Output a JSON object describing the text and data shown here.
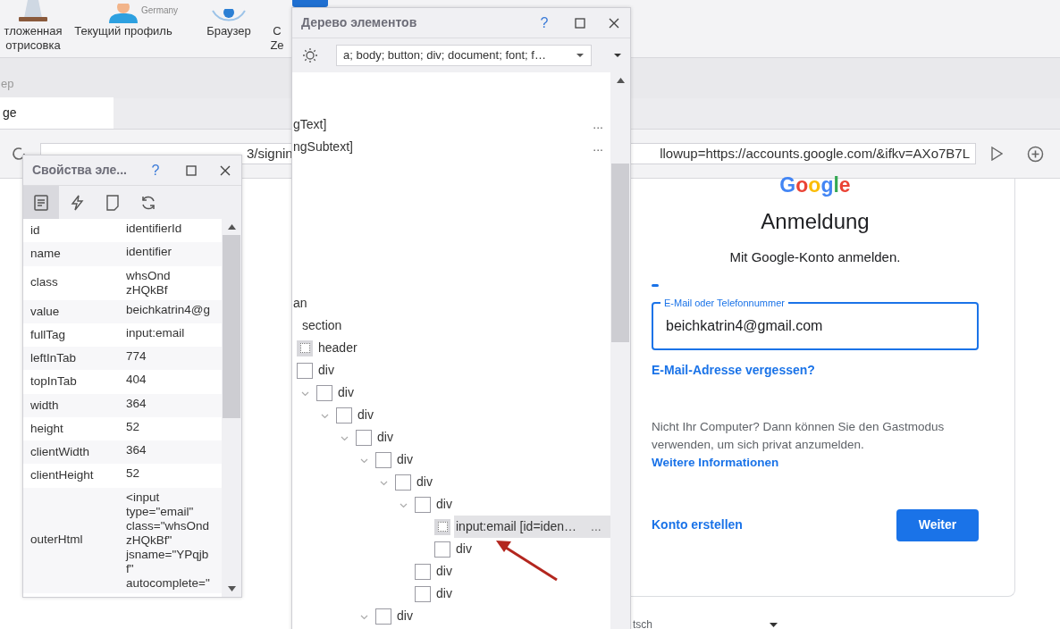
{
  "toolbar": {
    "items": [
      {
        "label": "тложенная\nотрисовка",
        "kind": "lamp"
      },
      {
        "label": "Текущий профиль",
        "kind": "person",
        "info": [
          "Germany"
        ]
      },
      {
        "label": "Браузер",
        "kind": "eye"
      },
      {
        "label": "С\nZe",
        "kind": "plain"
      }
    ]
  },
  "browser": {
    "caption": "ep",
    "tabs": [
      {
        "label": "ge",
        "selected": true
      }
    ],
    "address": {
      "start": "3/signin",
      "end": "llowup=https://accounts.google.com/&ifkv=AXo7B7L"
    },
    "page": {
      "logo": "Google",
      "title": "Anmeldung",
      "subtitle": "Mit Google-Konto anmelden.",
      "email_field": {
        "label": "E-Mail oder Telefonnummer",
        "value": "beichkatrin4@gmail.com",
        "focused": true
      },
      "forgot_link": "E-Mail-Adresse vergessen?",
      "guest_text": "Nicht Ihr Computer? Dann können Sie den Gastmodus verwenden, um sich privat anzumelden.",
      "more_link": "Weitere Informationen",
      "create_link": "Konto erstellen",
      "next_button": "Weiter",
      "language": "tsch"
    }
  },
  "properties_panel": {
    "title": "Свойства эле...",
    "help": "?",
    "tabs": [
      {
        "kind": "document",
        "selected": true
      },
      {
        "kind": "bolt",
        "selected": false
      },
      {
        "kind": "page",
        "selected": false
      },
      {
        "kind": "refresh",
        "selected": false
      }
    ],
    "rows": [
      {
        "name": "id",
        "value": "identifierId"
      },
      {
        "name": "name",
        "value": "identifier"
      },
      {
        "name": "class",
        "value": "whsOnd\nzHQkBf"
      },
      {
        "name": "value",
        "value": "beichkatrin4@g"
      },
      {
        "name": "fullTag",
        "value": "input:email"
      },
      {
        "name": "leftInTab",
        "value": "774"
      },
      {
        "name": "topInTab",
        "value": "404"
      },
      {
        "name": "width",
        "value": "364"
      },
      {
        "name": "height",
        "value": "52"
      },
      {
        "name": "clientWidth",
        "value": "364"
      },
      {
        "name": "clientHeight",
        "value": "52"
      },
      {
        "name": "outerHtml",
        "value": "<input\ntype=\"email\"\nclass=\"whsOnd\nzHQkBf\"\njsname=\"YPqjb\nf\"\nautocomplete=\""
      }
    ]
  },
  "tree_panel": {
    "title": "Дерево элементов",
    "help": "?",
    "filter": "a; body; button; div; document; font; f…",
    "partial_rows": [
      {
        "label": "gText]",
        "more": "..."
      },
      {
        "label": "ngSubtext]",
        "more": "..."
      },
      {
        "label": "an"
      }
    ],
    "items": [
      {
        "label": "section",
        "kind": "plain",
        "selected": false
      },
      {
        "label": "header",
        "kind": "dotted",
        "selected": false
      },
      {
        "label": "div",
        "kind": "box",
        "selected": false,
        "children": [
          {
            "label": "div",
            "kind": "box",
            "selected": false,
            "expanded": true,
            "children": [
              {
                "label": "div",
                "kind": "box",
                "selected": false,
                "expanded": true,
                "children": [
                  {
                    "label": "div",
                    "kind": "box",
                    "selected": false,
                    "expanded": true,
                    "children": [
                      {
                        "label": "div",
                        "kind": "box",
                        "selected": false,
                        "expanded": true,
                        "children": [
                          {
                            "label": "div",
                            "kind": "box",
                            "selected": false,
                            "expanded": true,
                            "children": [
                              {
                                "label": "div",
                                "kind": "box",
                                "selected": false,
                                "expanded": true,
                                "children": [
                                  {
                                    "label": "input:email [id=iden…",
                                    "kind": "dotted",
                                    "selected": true,
                                    "more": "..."
                                  },
                                  {
                                    "label": "div",
                                    "kind": "box",
                                    "selected": false
                                  }
                                ]
                              },
                              {
                                "label": "div",
                                "kind": "box",
                                "selected": false
                              },
                              {
                                "label": "div",
                                "kind": "box",
                                "selected": false
                              }
                            ]
                          }
                        ]
                      },
                      {
                        "label": "div",
                        "kind": "box",
                        "selected": false,
                        "expanded": true
                      }
                    ]
                  }
                ]
              }
            ]
          }
        ]
      }
    ]
  }
}
